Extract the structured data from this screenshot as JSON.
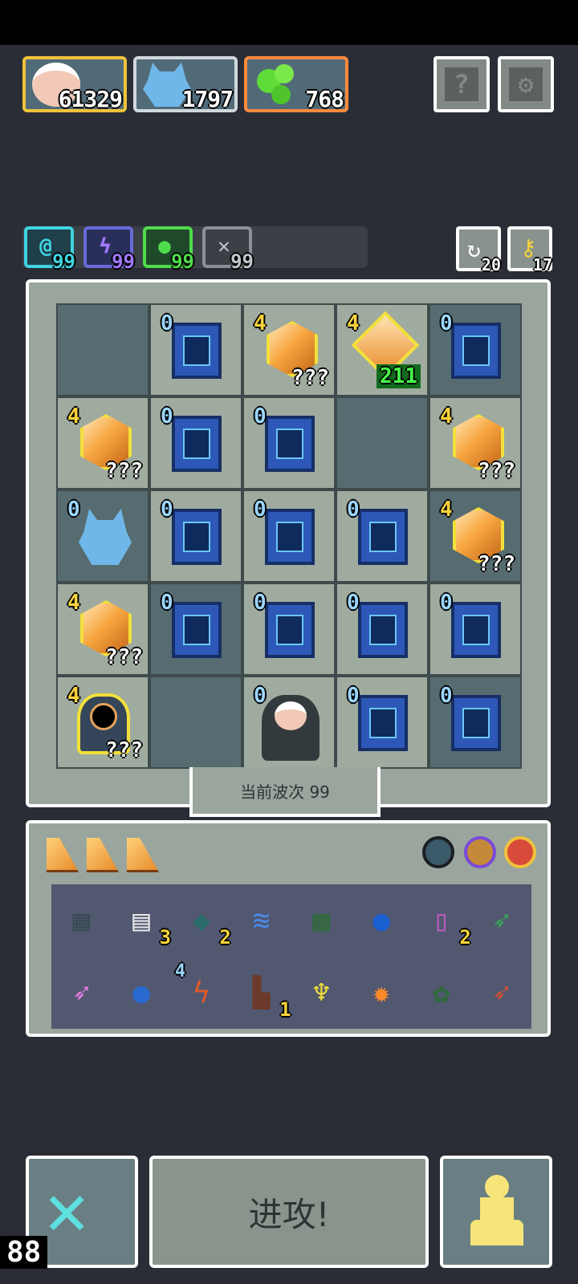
{
  "resources": [
    {
      "name": "portrait",
      "value": "61329",
      "border": "#f0c23b"
    },
    {
      "name": "monster",
      "value": "1797",
      "border": "#cfd8dc"
    },
    {
      "name": "slime",
      "value": "768",
      "border": "#ff8a3d"
    }
  ],
  "topButtons": {
    "help": "?",
    "settings": "gear-icon"
  },
  "buffs": [
    {
      "name": "spiral",
      "value": "99",
      "color": "#3fd4e0",
      "glyph": "@"
    },
    {
      "name": "lightning",
      "value": "99",
      "color": "#a178ff",
      "glyph": "ϟ"
    },
    {
      "name": "leaf",
      "value": "99",
      "color": "#4fdc4a",
      "glyph": "●"
    },
    {
      "name": "sword",
      "value": "99",
      "color": "#bfc6c9",
      "glyph": "✕"
    }
  ],
  "sideButtons": {
    "rotate": "20",
    "key": "17"
  },
  "board": [
    [
      {
        "t": "empty",
        "s": "dark"
      },
      {
        "t": "shrine",
        "s": "light",
        "tag": "0"
      },
      {
        "t": "crystal",
        "s": "light",
        "tag": "4",
        "q": "???"
      },
      {
        "t": "diamond",
        "s": "light",
        "tag": "4",
        "green": "211"
      },
      {
        "t": "shrine",
        "s": "dark",
        "tag": "0"
      }
    ],
    [
      {
        "t": "crystal",
        "s": "light",
        "tag": "4",
        "q": "???"
      },
      {
        "t": "shrine",
        "s": "light",
        "tag": "0"
      },
      {
        "t": "shrine",
        "s": "light",
        "tag": "0"
      },
      {
        "t": "empty",
        "s": "dark"
      },
      {
        "t": "crystal",
        "s": "light",
        "tag": "4",
        "q": "???"
      }
    ],
    [
      {
        "t": "monster",
        "s": "dark",
        "tag": "0"
      },
      {
        "t": "shrine",
        "s": "light",
        "tag": "0"
      },
      {
        "t": "shrine",
        "s": "light",
        "tag": "0"
      },
      {
        "t": "shrine",
        "s": "light",
        "tag": "0"
      },
      {
        "t": "crystal",
        "s": "dark",
        "tag": "4",
        "q": "???"
      }
    ],
    [
      {
        "t": "crystal",
        "s": "light",
        "tag": "4",
        "q": "???"
      },
      {
        "t": "shrine",
        "s": "dark",
        "tag": "0"
      },
      {
        "t": "shrine",
        "s": "light",
        "tag": "0"
      },
      {
        "t": "shrine",
        "s": "light",
        "tag": "0"
      },
      {
        "t": "shrine",
        "s": "light",
        "tag": "0"
      }
    ],
    [
      {
        "t": "portal",
        "s": "light",
        "tag": "4",
        "q": "???"
      },
      {
        "t": "empty",
        "s": "dark"
      },
      {
        "t": "hero",
        "s": "light",
        "tag": "0"
      },
      {
        "t": "shrine",
        "s": "light",
        "tag": "0"
      },
      {
        "t": "shrine",
        "s": "dark",
        "tag": "0"
      }
    ]
  ],
  "wave": {
    "label": "当前波次 99"
  },
  "inventoryTop": {
    "wedges": 3,
    "orbs": [
      "#3b5a6a",
      "#c48a3a",
      "#d84b3b"
    ]
  },
  "inventory": [
    {
      "name": "stone-tile",
      "glyph": "▦",
      "color": "#3a4b55"
    },
    {
      "name": "scroll",
      "glyph": "▤",
      "color": "#e8e8e8",
      "count": "3"
    },
    {
      "name": "gem-heart",
      "glyph": "◆",
      "color": "#2a6b6b",
      "count": "2"
    },
    {
      "name": "wave",
      "glyph": "≋",
      "color": "#4a8ae8"
    },
    {
      "name": "leaf-tile",
      "glyph": "▩",
      "color": "#2f6b3a"
    },
    {
      "name": "water-tile",
      "glyph": "●",
      "color": "#1a5fd0"
    },
    {
      "name": "potion",
      "glyph": "▯",
      "color": "#c05ac0",
      "count": "2"
    },
    {
      "name": "arrow-green",
      "glyph": "➶",
      "color": "#3aa35a"
    },
    {
      "name": "arrow-pink",
      "glyph": "➶",
      "color": "#e07ae0"
    },
    {
      "name": "drop",
      "glyph": "●",
      "color": "#2a6ad0"
    },
    {
      "name": "lightning-tile",
      "glyph": "ϟ",
      "color": "#e05a2a",
      "count4": "4"
    },
    {
      "name": "boot",
      "glyph": "▙",
      "color": "#6b3a2a",
      "count": "1"
    },
    {
      "name": "goblet",
      "glyph": "♆",
      "color": "#f3e03b"
    },
    {
      "name": "fire-tile",
      "glyph": "✹",
      "color": "#ff8a2a"
    },
    {
      "name": "rose-tile",
      "glyph": "✿",
      "color": "#2f6b3a"
    },
    {
      "name": "arrow-red",
      "glyph": "➶",
      "color": "#d0503a"
    }
  ],
  "bottom": {
    "attack": "进攻!",
    "fps": "88"
  }
}
